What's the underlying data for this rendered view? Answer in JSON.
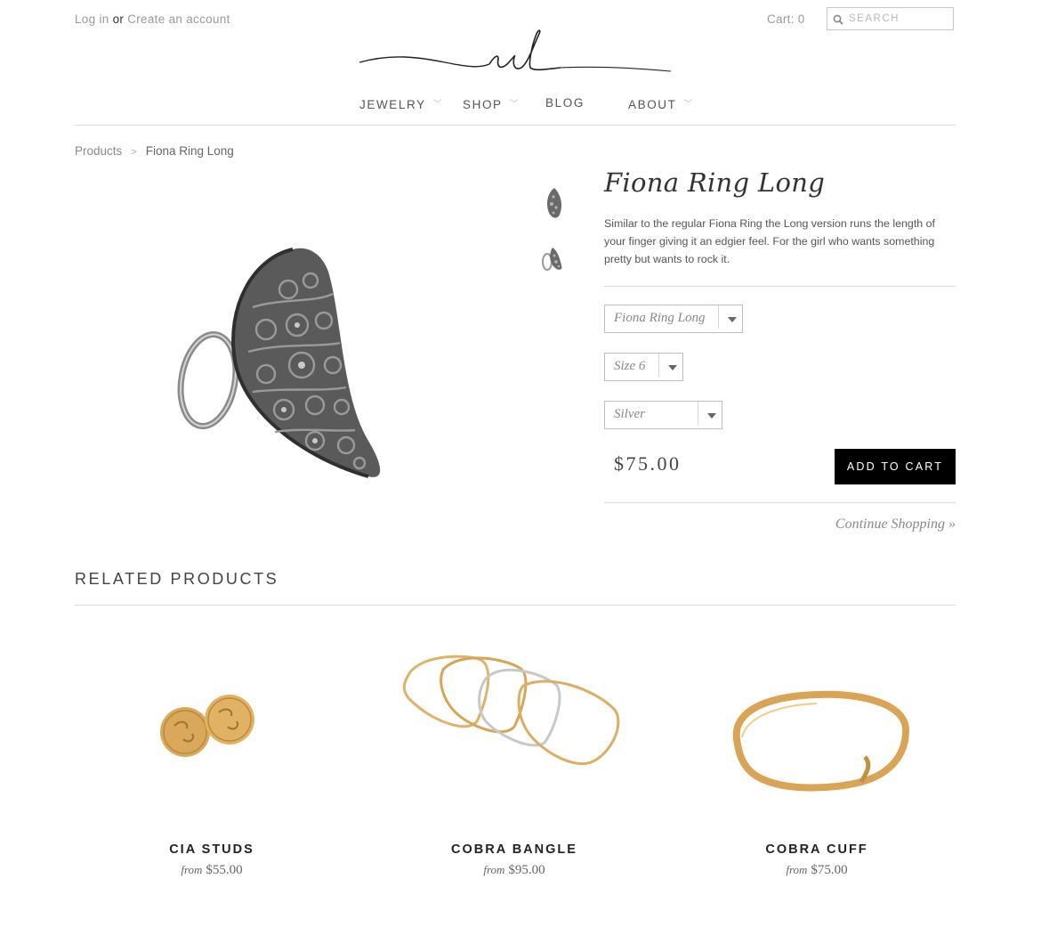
{
  "header": {
    "login": "Log in",
    "or": "or",
    "create_account": "Create an account",
    "cart": "Cart: 0",
    "search_placeholder": "SEARCH",
    "nav": [
      "JEWELRY",
      "SHOP",
      "BLOG",
      "ABOUT"
    ]
  },
  "breadcrumb": {
    "root": "Products",
    "separator": ">",
    "current": "Fiona Ring Long"
  },
  "product": {
    "title": "Fiona Ring Long",
    "description": " Similar to the regular Fiona Ring the Long version runs the length of your finger giving it an edgier feel. For the girl who wants something pretty but wants to rock it.",
    "options": {
      "style": "Fiona Ring Long",
      "size": "Size 6",
      "metal": "Silver"
    },
    "price": "$75.00",
    "add_to_cart": "ADD TO CART",
    "continue": "Continue Shopping »"
  },
  "related": {
    "heading": "RELATED PRODUCTS",
    "from_label": "from",
    "items": [
      {
        "name": "CIA STUDS",
        "price": "$55.00"
      },
      {
        "name": "COBRA BANGLE",
        "price": "$95.00"
      },
      {
        "name": "COBRA CUFF",
        "price": "$75.00"
      }
    ]
  },
  "colors": {
    "button": "#000000",
    "gold": "#d9a85a",
    "silver": "#6e6e6e"
  }
}
